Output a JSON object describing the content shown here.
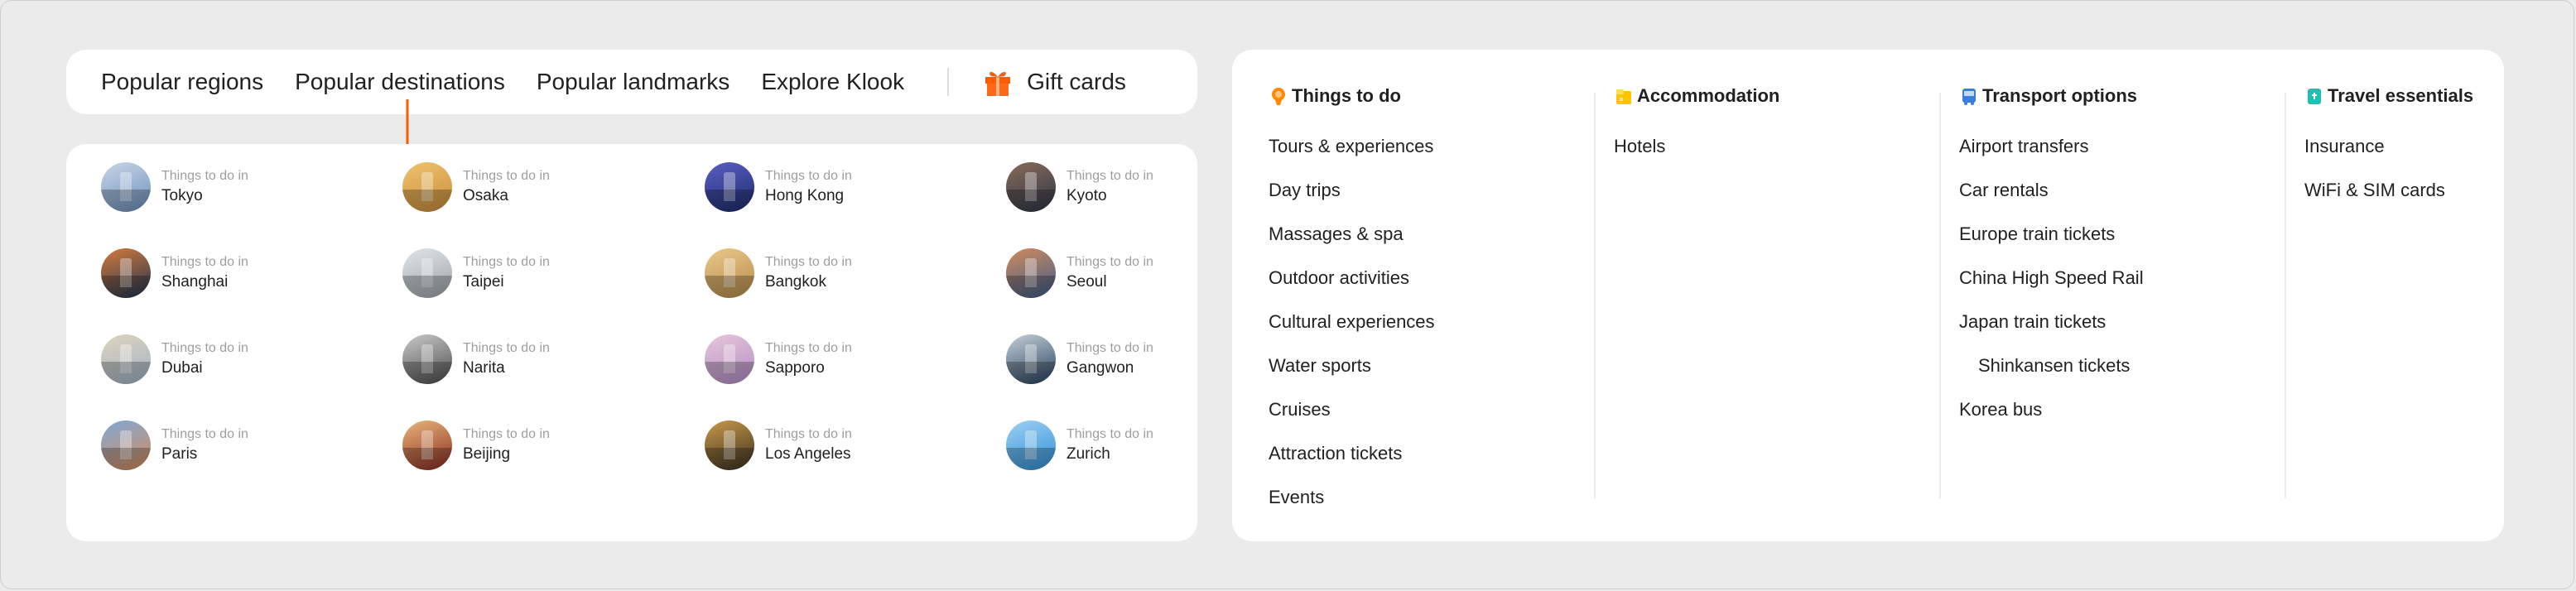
{
  "nav": {
    "tabs": [
      "Popular regions",
      "Popular destinations",
      "Popular landmarks",
      "Explore Klook"
    ],
    "gift_label": "Gift cards",
    "accent": "#ff5b00"
  },
  "destinations": {
    "prefix": "Things to do in",
    "items": [
      {
        "name": "Tokyo",
        "color1": "#6a8fbd",
        "color2": "#c9d6e6"
      },
      {
        "name": "Osaka",
        "color1": "#c98b3a",
        "color2": "#efc46f"
      },
      {
        "name": "Hong Kong",
        "color1": "#1d2b6b",
        "color2": "#5a5fc4"
      },
      {
        "name": "Kyoto",
        "color1": "#2c3748",
        "color2": "#8a6a58"
      },
      {
        "name": "Shanghai",
        "color1": "#1f3550",
        "color2": "#d57a3a"
      },
      {
        "name": "Taipei",
        "color1": "#9aa3a8",
        "color2": "#e1e5e8"
      },
      {
        "name": "Bangkok",
        "color1": "#b98a4a",
        "color2": "#e8c98a"
      },
      {
        "name": "Seoul",
        "color1": "#3b5c8c",
        "color2": "#d28b5a"
      },
      {
        "name": "Dubai",
        "color1": "#9fb5c8",
        "color2": "#e0d3bb"
      },
      {
        "name": "Narita",
        "color1": "#4c4c4c",
        "color2": "#c9c9c9"
      },
      {
        "name": "Sapporo",
        "color1": "#b38cc7",
        "color2": "#e7c7d9"
      },
      {
        "name": "Gangwon",
        "color1": "#27405c",
        "color2": "#c5d0da"
      },
      {
        "name": "Paris",
        "color1": "#d58b5a",
        "color2": "#7fa9d6"
      },
      {
        "name": "Beijing",
        "color1": "#8a2a1f",
        "color2": "#e8b77a"
      },
      {
        "name": "Los Angeles",
        "color1": "#3a3020",
        "color2": "#c99a4a"
      },
      {
        "name": "Zurich",
        "color1": "#2d8fd6",
        "color2": "#9fd0f2"
      }
    ]
  },
  "categories": [
    {
      "title": "Things to do",
      "icon": "balloon-icon",
      "icon_color": "#ff8a00",
      "items": [
        "Tours & experiences",
        "Day trips",
        "Massages & spa",
        "Outdoor activities",
        "Cultural experiences",
        "Water sports",
        "Cruises",
        "Attraction tickets",
        "Events"
      ]
    },
    {
      "title": "Accommodation",
      "icon": "hotel-icon",
      "icon_color": "#ffc400",
      "items": [
        "Hotels"
      ]
    },
    {
      "title": "Transport options",
      "icon": "bus-icon",
      "icon_color": "#3b7ddd",
      "items": [
        "Airport transfers",
        "Car rentals",
        "Europe train tickets",
        "China High Speed Rail",
        "Japan train tickets",
        "Shinkansen tickets",
        "Korea bus"
      ],
      "indented": [
        5
      ]
    },
    {
      "title": "Travel essentials",
      "icon": "sim-card-icon",
      "icon_color": "#1fc0b4",
      "items": [
        "Insurance",
        "WiFi & SIM cards"
      ]
    }
  ]
}
